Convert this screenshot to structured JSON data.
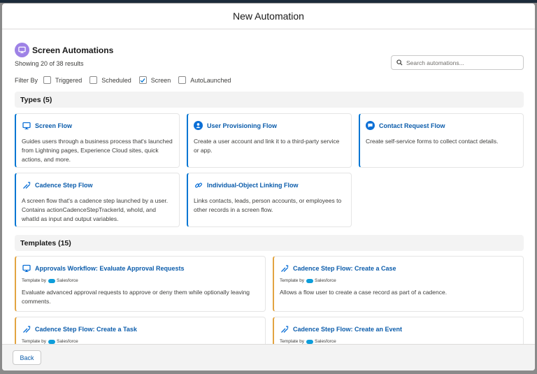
{
  "modal": {
    "title": "New Automation"
  },
  "heading": {
    "title": "Screen Automations",
    "count": "Showing 20 of 38 results"
  },
  "search": {
    "placeholder": "Search automations..."
  },
  "filters": {
    "label": "Filter By",
    "options": [
      {
        "label": "Triggered",
        "checked": false
      },
      {
        "label": "Scheduled",
        "checked": false
      },
      {
        "label": "Screen",
        "checked": true
      },
      {
        "label": "AutoLaunched",
        "checked": false
      }
    ]
  },
  "types": {
    "header": "Types (5)",
    "items": [
      {
        "icon": "screen-icon",
        "title": "Screen Flow",
        "desc": "Guides users through a business process that's launched from Lightning pages, Experience Cloud sites, quick actions, and more."
      },
      {
        "icon": "user-icon",
        "title": "User Provisioning Flow",
        "desc": "Create a user account and link it to a third-party service or app."
      },
      {
        "icon": "contact-request-icon",
        "title": "Contact Request Flow",
        "desc": "Create self-service forms to collect contact details."
      },
      {
        "icon": "cadence-icon",
        "title": "Cadence Step Flow",
        "desc": "A screen flow that's a cadence step launched by a user. Contains actionCadenceStepTrackerId, whoId, and whatId as input and output variables."
      },
      {
        "icon": "link-icon",
        "title": "Individual-Object Linking Flow",
        "desc": "Links contacts, leads, person accounts, or employees to other records in a screen flow."
      }
    ]
  },
  "templates": {
    "header": "Templates (15)",
    "by_label": "Template by",
    "publisher": "Salesforce",
    "items": [
      {
        "icon": "screen-icon",
        "title": "Approvals Workflow: Evaluate Approval Requests",
        "desc": "Evaluate advanced approval requests to approve or deny them while optionally leaving comments."
      },
      {
        "icon": "cadence-icon",
        "title": "Cadence Step Flow: Create a Case",
        "desc": "Allows a flow user to create a case record as part of a cadence."
      },
      {
        "icon": "cadence-icon",
        "title": "Cadence Step Flow: Create a Task",
        "desc": ""
      },
      {
        "icon": "cadence-icon",
        "title": "Cadence Step Flow: Create an Event",
        "desc": ""
      }
    ]
  },
  "footer": {
    "back_label": "Back"
  },
  "colors": {
    "accent": "#0176d3",
    "link": "#0b5cab",
    "template_border": "#e2a441",
    "heading_icon_bg": "#9e82e6"
  }
}
